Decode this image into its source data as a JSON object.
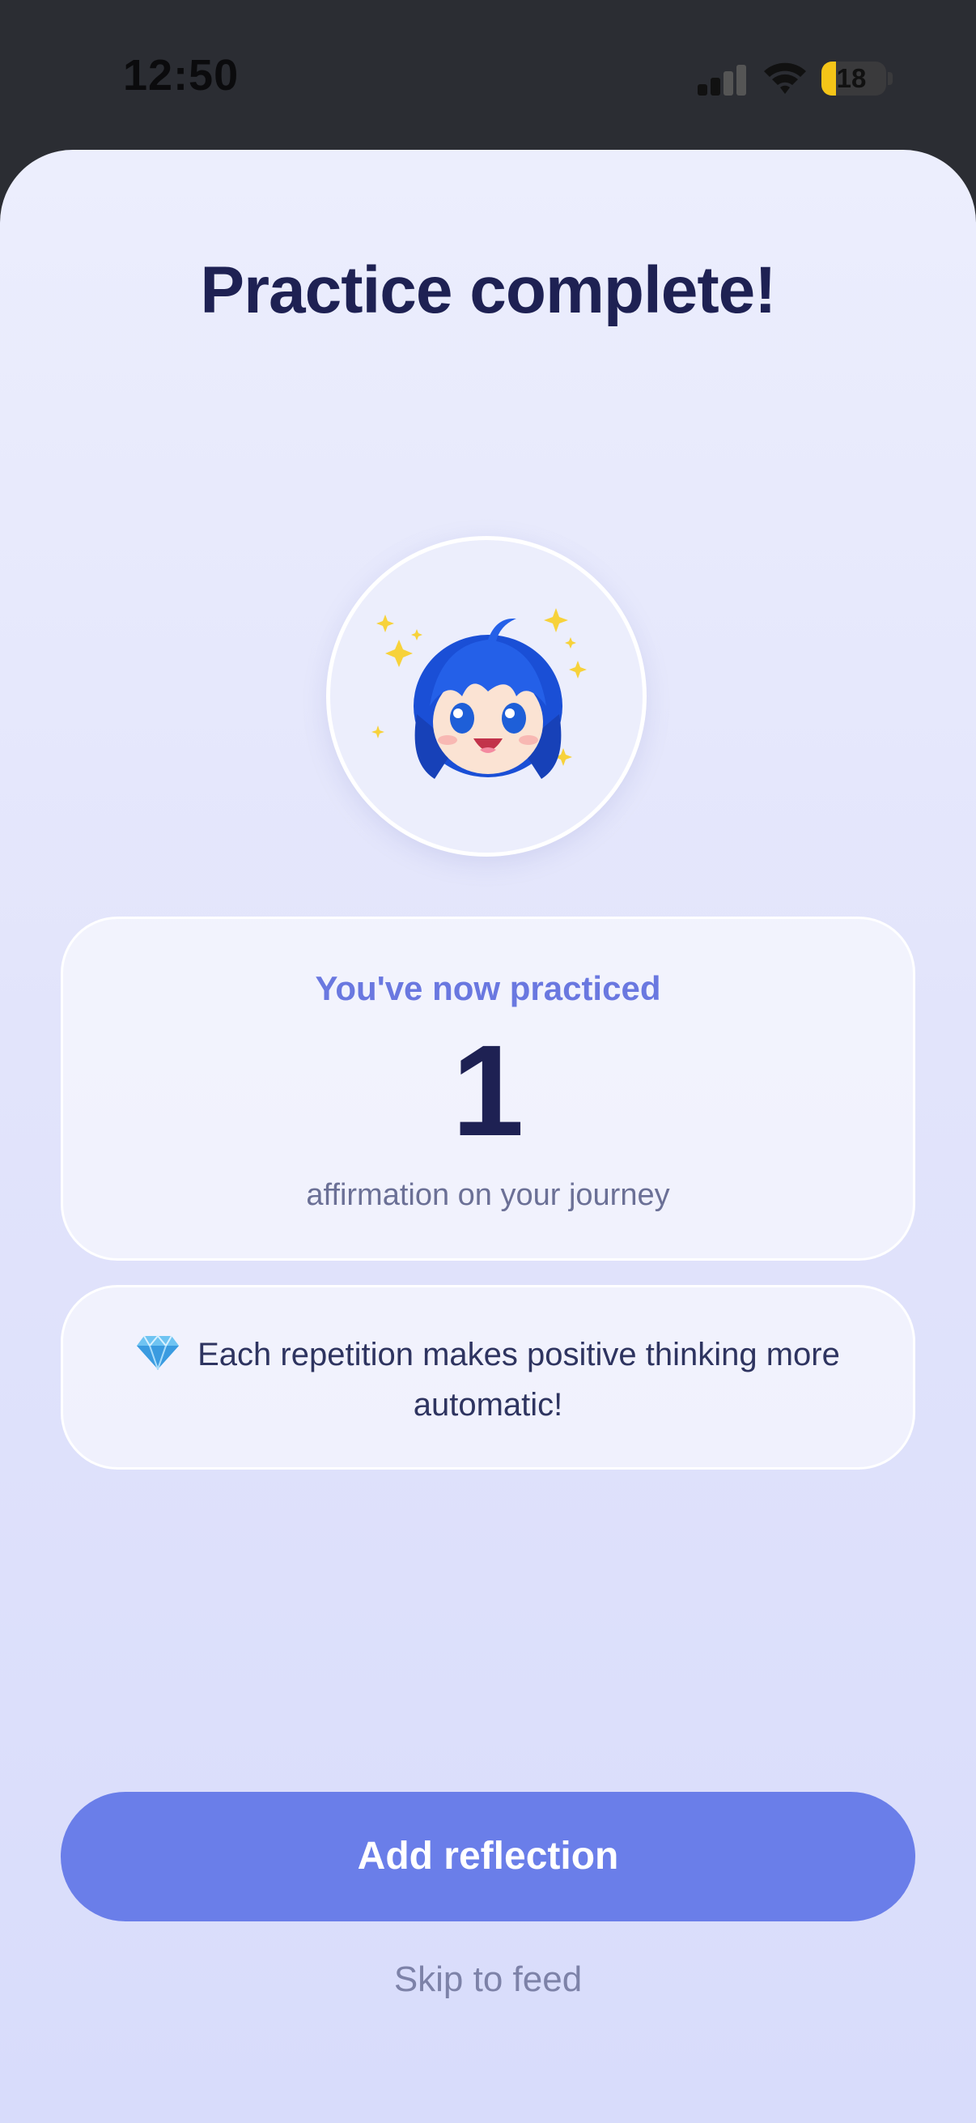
{
  "status_bar": {
    "time": "12:50",
    "battery_level": "18"
  },
  "title": "Practice complete!",
  "avatar": {
    "icon": "happy-anime-character-with-sparkles"
  },
  "progress_card": {
    "label": "You've now practiced",
    "count": "1",
    "subtitle": "affirmation on your journey"
  },
  "tip_card": {
    "icon": "gem-icon",
    "text": "Each repetition makes positive thinking more automatic!"
  },
  "actions": {
    "primary": "Add reflection",
    "secondary": "Skip to feed"
  },
  "colors": {
    "accent": "#6a7ee9",
    "title": "#1e2153",
    "label": "#6a78e0"
  }
}
